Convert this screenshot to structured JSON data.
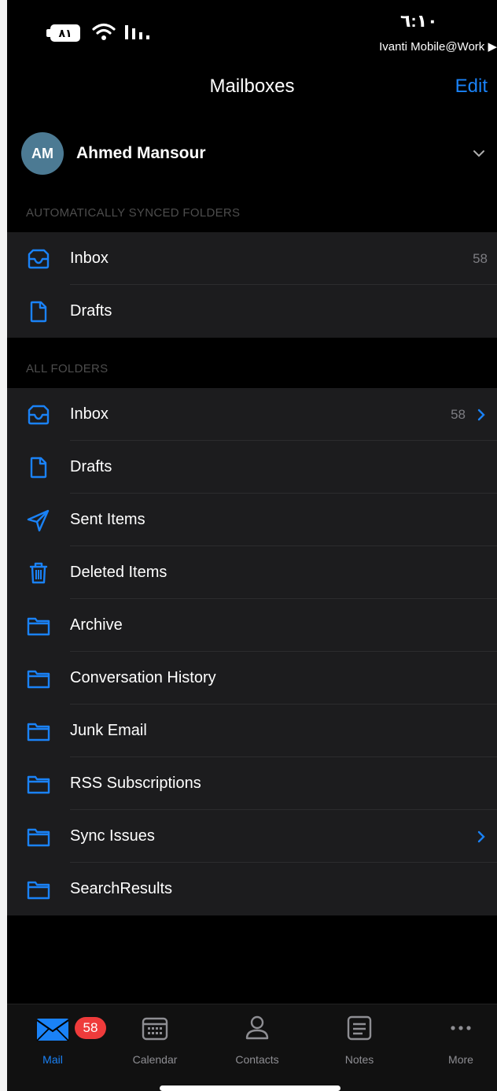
{
  "status_bar": {
    "battery": "٨١",
    "time": "٦:١٠",
    "vpn_label": "Ivanti Mobile@Work ▶"
  },
  "nav": {
    "title": "Mailboxes",
    "edit_label": "Edit"
  },
  "account": {
    "initials": "AM",
    "name": "Ahmed Mansour"
  },
  "synced_section": {
    "header": "AUTOMATICALLY SYNCED FOLDERS",
    "folders": [
      {
        "label": "Inbox",
        "count": "58",
        "icon": "inbox-icon"
      },
      {
        "label": "Drafts",
        "icon": "draft-icon"
      }
    ]
  },
  "all_section": {
    "header": "ALL FOLDERS",
    "folders": [
      {
        "label": "Inbox",
        "count": "58",
        "icon": "inbox-icon",
        "expandable": true
      },
      {
        "label": "Drafts",
        "icon": "draft-icon"
      },
      {
        "label": "Sent Items",
        "icon": "sent-icon"
      },
      {
        "label": "Deleted Items",
        "icon": "trash-icon"
      },
      {
        "label": "Archive",
        "icon": "folder-icon"
      },
      {
        "label": "Conversation History",
        "icon": "folder-icon"
      },
      {
        "label": "Junk Email",
        "icon": "folder-icon"
      },
      {
        "label": "RSS Subscriptions",
        "icon": "folder-icon"
      },
      {
        "label": "Sync Issues",
        "icon": "folder-icon",
        "expandable": true
      },
      {
        "label": "SearchResults",
        "icon": "folder-icon"
      }
    ]
  },
  "tab_bar": {
    "mail": {
      "label": "Mail",
      "badge": "58",
      "icon": "mail-icon"
    },
    "calendar": {
      "label": "Calendar",
      "icon": "calendar-icon"
    },
    "contacts": {
      "label": "Contacts",
      "icon": "contacts-icon"
    },
    "notes": {
      "label": "Notes",
      "icon": "notes-icon"
    },
    "more": {
      "label": "More",
      "icon": "more-icon"
    }
  },
  "colors": {
    "accent": "#1a82f7",
    "background": "#000000",
    "group_background": "#1c1c1e",
    "badge": "#ef3b3b"
  }
}
